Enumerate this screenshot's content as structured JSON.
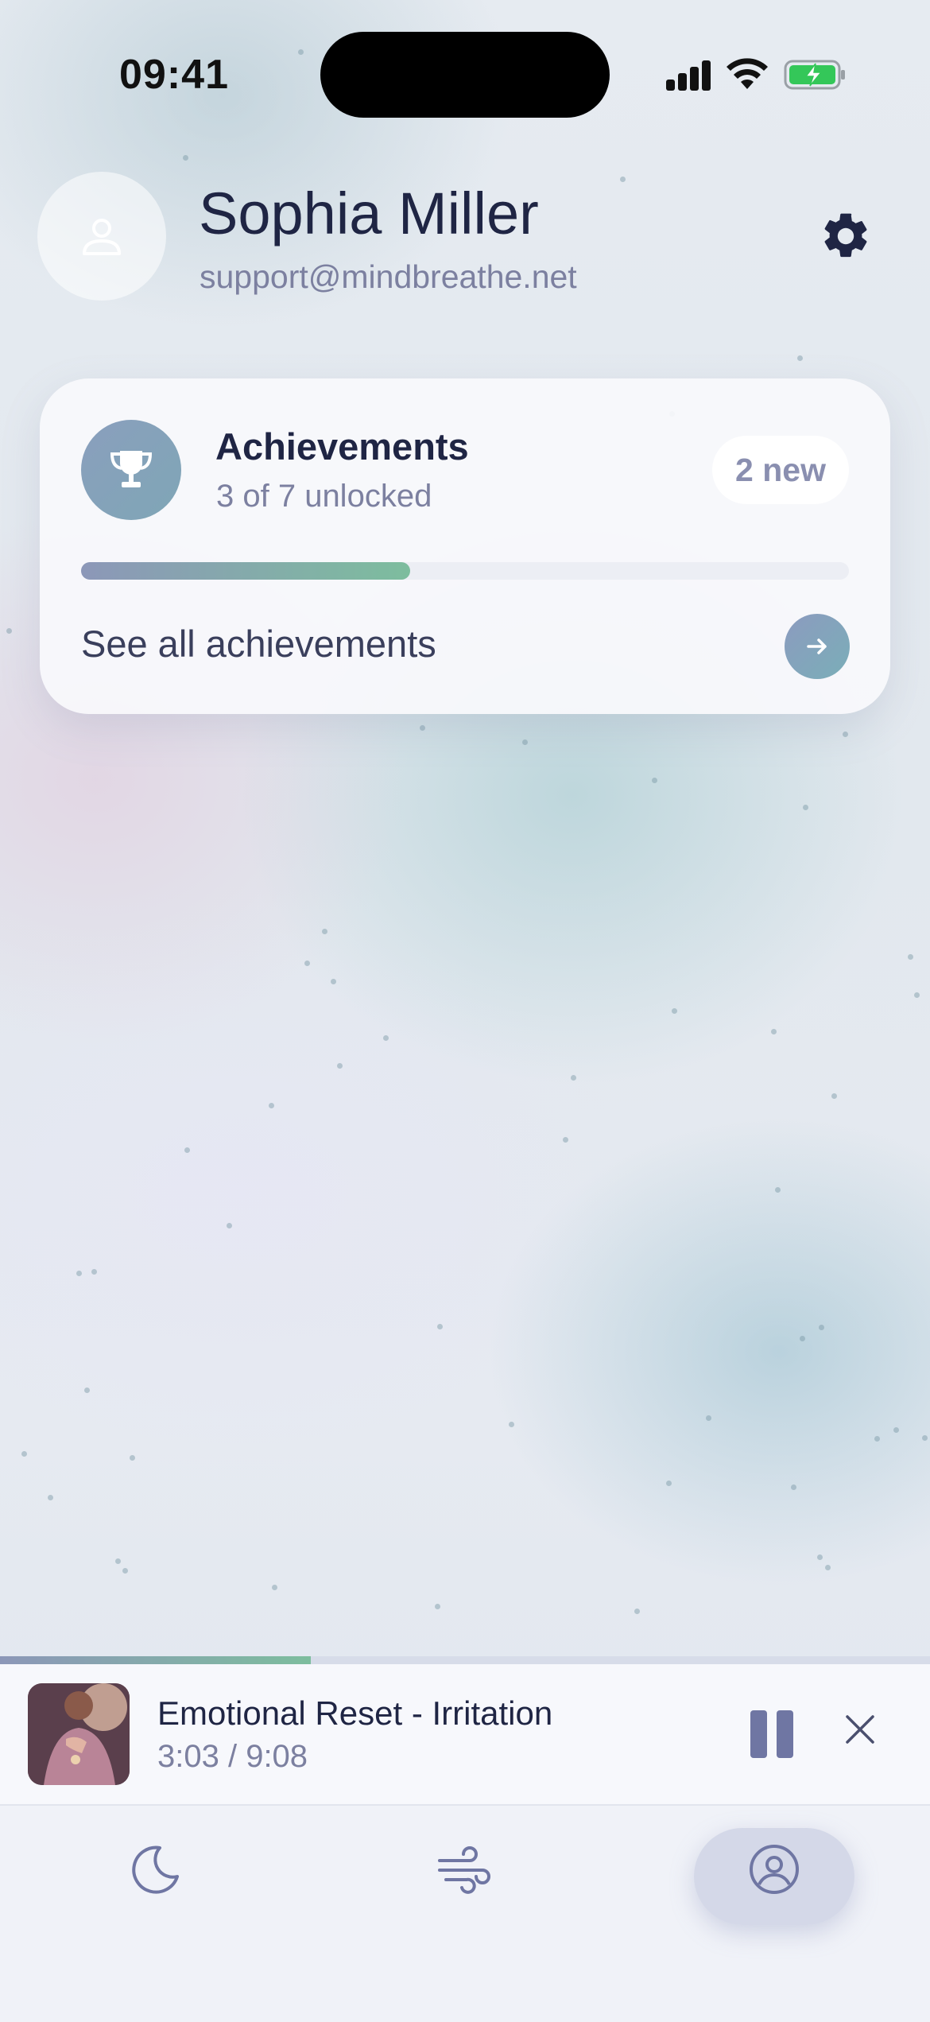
{
  "status_bar": {
    "time": "09:41"
  },
  "profile": {
    "name": "Sophia Miller",
    "email": "support@mindbreathe.net"
  },
  "achievements": {
    "title": "Achievements",
    "subtitle": "3 of 7 unlocked",
    "badge": "2 new",
    "progress_fraction": 0.4286,
    "see_all_label": "See all achievements"
  },
  "player": {
    "track_title": "Emotional Reset - Irritation",
    "track_time": "3:03 / 9:08",
    "progress_fraction": 0.334
  },
  "tabs": [
    {
      "icon": "moon-icon",
      "active": false
    },
    {
      "icon": "wind-icon",
      "active": false
    },
    {
      "icon": "profile-icon",
      "active": true
    }
  ],
  "colors": {
    "text_primary": "#1f2544",
    "text_secondary": "#7c80a0",
    "accent_gradient_start": "#8c97b8",
    "accent_gradient_end": "#7dbd9e",
    "battery_green": "#34c759"
  }
}
